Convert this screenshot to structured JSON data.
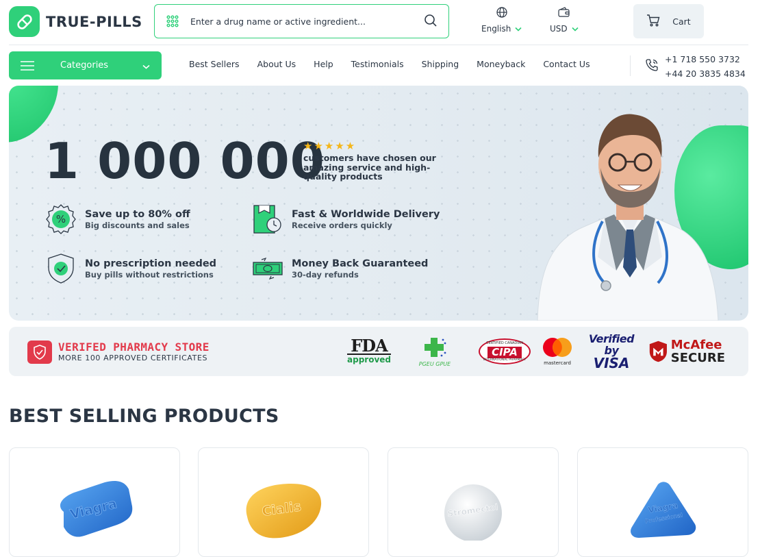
{
  "brand": {
    "name": "TRUE-PILLS"
  },
  "search": {
    "placeholder": "Enter a drug name or active ingredient..."
  },
  "language": {
    "label": "English"
  },
  "currency": {
    "label": "USD"
  },
  "cart": {
    "label": "Cart"
  },
  "nav": {
    "categories_label": "Categories",
    "links": [
      "Best Sellers",
      "About Us",
      "Help",
      "Testimonials",
      "Shipping",
      "Moneyback",
      "Contact Us"
    ]
  },
  "contact": {
    "phone_us": "+1 718 550 3732",
    "phone_uk": "+44 20 3835 4834"
  },
  "hero": {
    "customers_count": "1 000 000",
    "rating_stars": 5,
    "customers_note": "customers have chosen our amazing service and high-quality products",
    "features": [
      {
        "title": "Save up to 80% off",
        "subtitle": "Big discounts and sales",
        "icon": "percent-badge-icon"
      },
      {
        "title": "Fast & Worldwide Delivery",
        "subtitle": "Receive orders quickly",
        "icon": "delivery-clock-icon"
      },
      {
        "title": "No prescription needed",
        "subtitle": "Buy pills without restrictions",
        "icon": "shield-check-icon"
      },
      {
        "title": "Money Back Guaranteed",
        "subtitle": "30-day refunds",
        "icon": "money-icon"
      }
    ]
  },
  "certificates": {
    "title": "VERIFED PHARMACY STORE",
    "subtitle": "MORE 100 APPROVED CERTIFICATES",
    "logos": {
      "fda_main": "FDA",
      "fda_sub": "approved",
      "pgeu": "PGEU GPUE",
      "cipa_top": "CERTIFIED CANADIAN",
      "cipa": "CIPA",
      "cipa_bottom": "INTERNATIONAL PHARMACY",
      "mastercard": "mastercard",
      "visa_top": "Verified by",
      "visa": "VISA",
      "mcafee_top": "McAfee",
      "mcafee_bottom": "SECURE"
    }
  },
  "best_selling": {
    "title": "BEST SELLING PRODUCTS",
    "products": [
      {
        "pill_text": "Viagra",
        "color": "#2f7fe0"
      },
      {
        "pill_text": "Cialis",
        "color": "#f3b52e"
      },
      {
        "pill_text": "Stromectol",
        "color": "#e8ecef"
      },
      {
        "pill_text": "Viagra",
        "pill_subtext": "Professional",
        "color": "#2f7fe0"
      }
    ]
  },
  "colors": {
    "accent": "#2fd07a",
    "dark_text": "#2b3644",
    "cert_red": "#e23a4b",
    "star": "#f4b619"
  }
}
